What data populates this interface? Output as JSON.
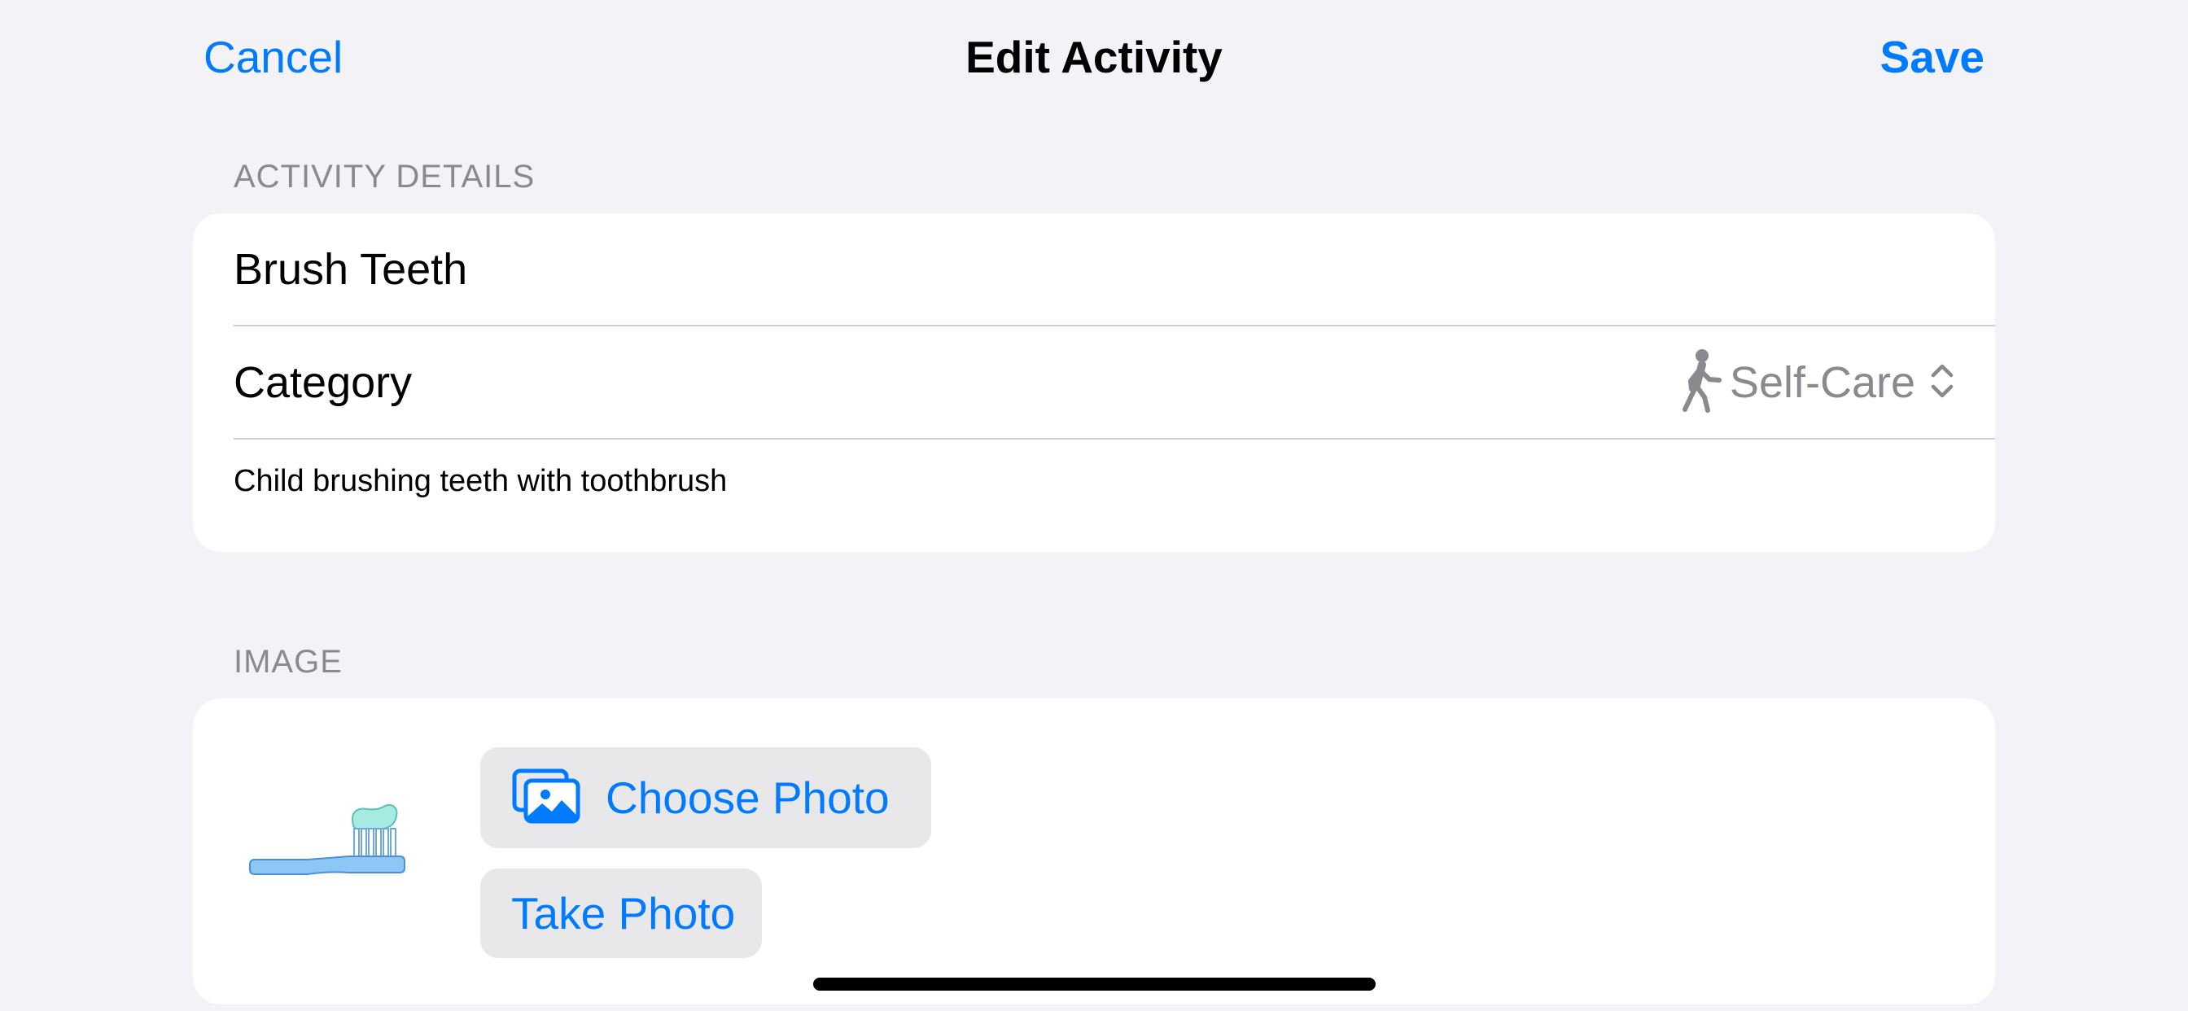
{
  "nav": {
    "cancel_label": "Cancel",
    "title": "Edit Activity",
    "save_label": "Save"
  },
  "sections": {
    "details_header": "ACTIVITY DETAILS",
    "image_header": "IMAGE"
  },
  "details": {
    "name_value": "Brush Teeth",
    "category_label": "Category",
    "category_value": "Self-Care",
    "category_icon": "figure-walk-icon",
    "description": "Child brushing teeth with toothbrush"
  },
  "image": {
    "thumbnail": "toothbrush-illustration",
    "choose_photo_label": "Choose Photo",
    "choose_photo_icon": "photos-icon",
    "take_photo_label": "Take Photo"
  },
  "colors": {
    "accent": "#007aff",
    "background": "#f2f2f7",
    "card": "#ffffff",
    "secondary_text": "#8a8a8e",
    "button_fill": "#e8e8ea"
  }
}
